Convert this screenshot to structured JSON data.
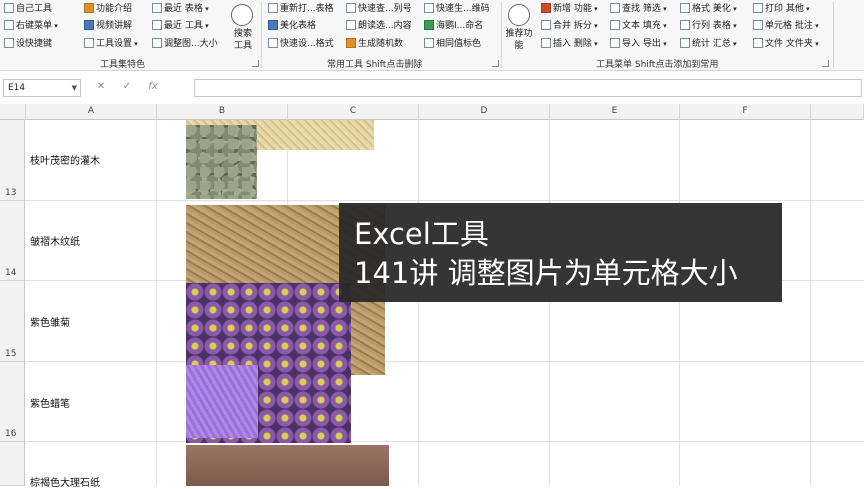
{
  "ribbon": {
    "col1": [
      "自己工具",
      "右键菜单",
      "设快捷键"
    ],
    "col2": [
      "功能介绍",
      "视频讲解",
      "工具设置"
    ],
    "col3": [
      "最近 表格",
      "最近 工具",
      "调整图...大小"
    ],
    "search_label": "搜索工具",
    "group1_label": "工具集特色",
    "col4": [
      "重新打...表格",
      "美化表格",
      "快速设...格式"
    ],
    "col5": [
      "快速查...列号",
      "朗读选...内容",
      "生成随机数"
    ],
    "col6": [
      "快速生...维码",
      "海鹦I...命名",
      "相同值标色"
    ],
    "group2_label": "常用工具 Shift点击删除",
    "recommend_label": "推荐功能",
    "col7": [
      "新增 功能",
      "合并 拆分",
      "插入 删除"
    ],
    "col8": [
      "查找 筛选",
      "文本 填充",
      "导入 导出"
    ],
    "col9": [
      "格式 美化",
      "行列 表格",
      "统计 汇总"
    ],
    "col10": [
      "打印 其他",
      "单元格 批注",
      "文件 文件夹"
    ],
    "group3_label": "工具菜单 Shift点击添加到常用"
  },
  "formula_bar": {
    "name_box": "E14",
    "cancel": "✕",
    "enter": "✓",
    "fx": "fx"
  },
  "columns": [
    "A",
    "B",
    "C",
    "D",
    "E",
    "F"
  ],
  "rows": [
    {
      "num": "13",
      "label": "枝叶茂密的灌木"
    },
    {
      "num": "14",
      "label": "皱褶木纹纸"
    },
    {
      "num": "15",
      "label": "紫色雏菊"
    },
    {
      "num": "16",
      "label": "紫色蜡笔"
    },
    {
      "num": "",
      "label": "棕褐色大理石纸"
    }
  ],
  "overlay": {
    "line1": "Excel工具",
    "line2": "141讲 调整图片为单元格大小"
  }
}
